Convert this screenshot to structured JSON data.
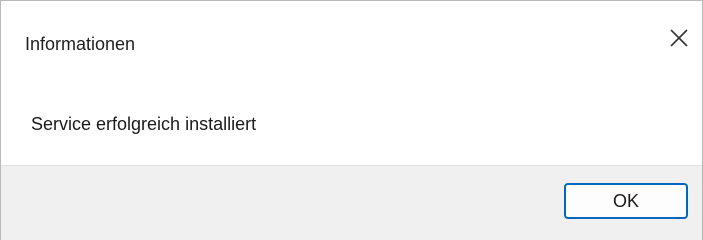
{
  "dialog": {
    "title": "Informationen",
    "close_icon": "close-icon",
    "message": "Service erfolgreich installiert",
    "ok_label": "OK"
  },
  "colors": {
    "accent": "#0067c0",
    "footer_bg": "#f0f0f0",
    "border": "#b9b9b9"
  }
}
